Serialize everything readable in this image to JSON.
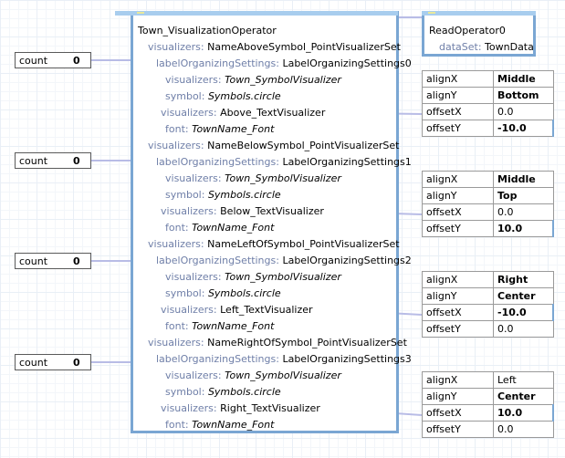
{
  "main_node": {
    "title": "Town_VisualizationOperator",
    "rows": [
      {
        "key": "visualizers:",
        "value": "NameAboveSymbol_PointVisualizerSet",
        "italic": false
      },
      {
        "key": "labelOrganizingSettings:",
        "value": "LabelOrganizingSettings0",
        "italic": false
      },
      {
        "key": "visualizers:",
        "value": "Town_SymbolVisualizer",
        "italic": true
      },
      {
        "key": "symbol:",
        "value": "Symbols.circle",
        "italic": true
      },
      {
        "key": "visualizers:",
        "value": "Above_TextVisualizer",
        "italic": false
      },
      {
        "key": "font:",
        "value": "TownName_Font",
        "italic": true
      },
      {
        "key": "visualizers:",
        "value": "NameBelowSymbol_PointVisualizerSet",
        "italic": false
      },
      {
        "key": "labelOrganizingSettings:",
        "value": "LabelOrganizingSettings1",
        "italic": false
      },
      {
        "key": "visualizers:",
        "value": "Town_SymbolVisualizer",
        "italic": true
      },
      {
        "key": "symbol:",
        "value": "Symbols.circle",
        "italic": true
      },
      {
        "key": "visualizers:",
        "value": "Below_TextVisualizer",
        "italic": false
      },
      {
        "key": "font:",
        "value": "TownName_Font",
        "italic": true
      },
      {
        "key": "visualizers:",
        "value": "NameLeftOfSymbol_PointVisualizerSet",
        "italic": false
      },
      {
        "key": "labelOrganizingSettings:",
        "value": "LabelOrganizingSettings2",
        "italic": false
      },
      {
        "key": "visualizers:",
        "value": "Town_SymbolVisualizer",
        "italic": true
      },
      {
        "key": "symbol:",
        "value": "Symbols.circle",
        "italic": true
      },
      {
        "key": "visualizers:",
        "value": "Left_TextVisualizer",
        "italic": false
      },
      {
        "key": "font:",
        "value": "TownName_Font",
        "italic": true
      },
      {
        "key": "visualizers:",
        "value": "NameRightOfSymbol_PointVisualizerSet",
        "italic": false
      },
      {
        "key": "labelOrganizingSettings:",
        "value": "LabelOrganizingSettings3",
        "italic": false
      },
      {
        "key": "visualizers:",
        "value": "Town_SymbolVisualizer",
        "italic": true
      },
      {
        "key": "symbol:",
        "value": "Symbols.circle",
        "italic": true
      },
      {
        "key": "visualizers:",
        "value": "Right_TextVisualizer",
        "italic": false
      },
      {
        "key": "font:",
        "value": "TownName_Font",
        "italic": true
      }
    ]
  },
  "read_node": {
    "title": "ReadOperator0",
    "key": "dataSet:",
    "value": "TownData"
  },
  "counts": [
    {
      "label": "count",
      "value": "0"
    },
    {
      "label": "count",
      "value": "0"
    },
    {
      "label": "count",
      "value": "0"
    },
    {
      "label": "count",
      "value": "0"
    }
  ],
  "align_tables": [
    {
      "alignX": "Middle",
      "alignY": "Bottom",
      "offsetX": "0.0",
      "offsetY": "-10.0"
    },
    {
      "alignX": "Middle",
      "alignY": "Top",
      "offsetX": "0.0",
      "offsetY": "10.0"
    },
    {
      "alignX": "Right",
      "alignY": "Center",
      "offsetX": "-10.0",
      "offsetY": "0.0"
    },
    {
      "alignX": "Left",
      "alignY": "Center",
      "offsetX": "10.0",
      "offsetY": "0.0"
    }
  ],
  "align_keys": {
    "alignX": "alignX",
    "alignY": "alignY",
    "offsetX": "offsetX",
    "offsetY": "offsetY"
  },
  "colors": {
    "node_border": "#7aa6d3",
    "key_text": "#6f7fa8",
    "wire": "#b8bce6"
  }
}
